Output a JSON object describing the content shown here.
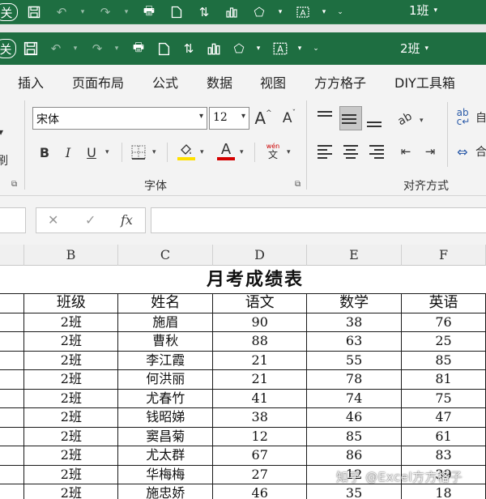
{
  "window": {
    "title_back": "1班",
    "title_front": "2班",
    "file_badge": "关"
  },
  "ribbon_tabs": [
    "插入",
    "页面布局",
    "公式",
    "数据",
    "视图",
    "方方格子",
    "DIY工具箱"
  ],
  "font_group": {
    "font_name": "宋体",
    "font_size": "12",
    "increase_label": "A",
    "decrease_label": "A",
    "bold": "B",
    "italic": "I",
    "underline": "U",
    "font_color_letter": "A",
    "phonetic_top": "wén",
    "phonetic_bottom": "文",
    "group_label": "字体",
    "highlight_color": "#ffe000",
    "font_color": "#d40000"
  },
  "align_group": {
    "group_label": "对齐方式",
    "wrap_label": "自",
    "merge_label": "合"
  },
  "clipboard_partial": "刷",
  "formula_bar": {
    "cancel": "✕",
    "enter": "✓",
    "fx": "fx"
  },
  "sheet": {
    "columns": [
      "B",
      "C",
      "D",
      "E",
      "F"
    ],
    "title": "月考成绩表",
    "headers": [
      "班级",
      "姓名",
      "语文",
      "数学",
      "英语"
    ],
    "rows": [
      [
        "2班",
        "施眉",
        "90",
        "38",
        "76"
      ],
      [
        "2班",
        "曹秋",
        "88",
        "63",
        "25"
      ],
      [
        "2班",
        "李江霞",
        "21",
        "55",
        "85"
      ],
      [
        "2班",
        "何洪丽",
        "21",
        "78",
        "81"
      ],
      [
        "2班",
        "尤春竹",
        "41",
        "74",
        "75"
      ],
      [
        "2班",
        "钱昭娣",
        "38",
        "46",
        "47"
      ],
      [
        "2班",
        "窦昌菊",
        "12",
        "85",
        "61"
      ],
      [
        "2班",
        "尤太群",
        "67",
        "86",
        "83"
      ],
      [
        "2班",
        "华梅梅",
        "27",
        "12",
        "39"
      ],
      [
        "2班",
        "施忠娇",
        "46",
        "35",
        "18"
      ]
    ]
  },
  "watermark": "知乎 @Excel方方格子",
  "colors": {
    "excel_green": "#1e6e41",
    "ribbon_bg": "#f3f3f3"
  }
}
